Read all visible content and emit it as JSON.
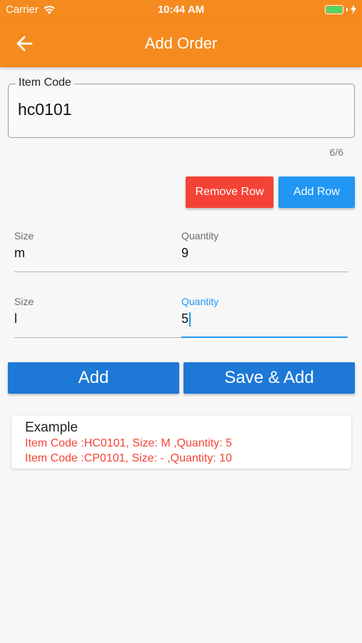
{
  "status_bar": {
    "carrier": "Carrier",
    "time": "10:44 AM",
    "battery_level": 1.0
  },
  "app_bar": {
    "title": "Add Order",
    "back_icon": "arrow-left-icon"
  },
  "item_code": {
    "label": "Item Code",
    "value": "hc0101",
    "counter": "6/6"
  },
  "row_actions": {
    "remove_label": "Remove Row",
    "add_label": "Add Row"
  },
  "rows": [
    {
      "size_label": "Size",
      "size_value": "m",
      "quantity_label": "Quantity",
      "quantity_value": "9"
    },
    {
      "size_label": "Size",
      "size_value": "l",
      "quantity_label": "Quantity",
      "quantity_value": "5"
    }
  ],
  "actions": {
    "add_label": "Add",
    "save_add_label": "Save & Add"
  },
  "example": {
    "title": "Example",
    "lines": [
      "Item Code :HC0101, Size: M ,Quantity: 5",
      "Item Code :CP0101, Size: - ,Quantity: 10"
    ]
  },
  "colors": {
    "primary": "#f58a1f",
    "accent": "#2196f3",
    "danger": "#f44336",
    "button_blue": "#1e78d6"
  }
}
